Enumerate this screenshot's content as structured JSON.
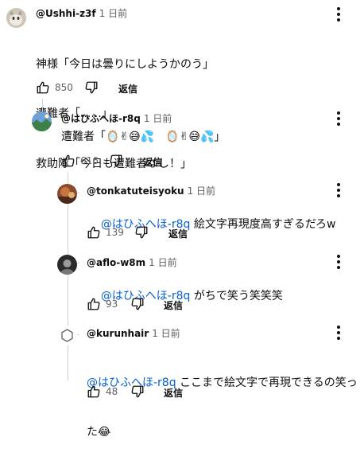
{
  "comments": [
    {
      "handle": "@Ushhi-z3f",
      "time": "1 日前",
      "lines": [
        "神様「今日は曇りにしようかのう」",
        "遭難者「......」",
        "救助隊「今日も遭難者なし！」"
      ],
      "likes": "850",
      "reply_label": "返信",
      "avatar_icon": "cat-avatar-icon"
    },
    {
      "handle": "@はひふへほ-r8q",
      "time": "1 日前",
      "text": "遭難者「🪞✌😅💦　🪞✌😅💦」",
      "likes": "616",
      "reply_label": "返信",
      "avatar_icon": "landscape-avatar-icon"
    },
    {
      "handle": "@tonkatuteisyoku",
      "time": "1 日前",
      "mention": "@はひふへほ-r8q",
      "text": " 絵文字再現度高すぎるだろw",
      "likes": "139",
      "reply_label": "返信",
      "avatar_icon": "photo-avatar-icon"
    },
    {
      "handle": "@aflo-w8m",
      "time": "1 日前",
      "mention": "@はひふへほ-r8q",
      "text": " がちで笑う笑笑笑",
      "likes": "93",
      "reply_label": "返信",
      "avatar_icon": "dark-avatar-icon"
    },
    {
      "handle": "@kurunhair",
      "time": "1 日前",
      "mention": "@はひふへほ-r8q",
      "text": " ここまで絵文字で再現できるの笑っ",
      "text2": "た😂",
      "likes": "48",
      "reply_label": "返信",
      "avatar_icon": "hexagon-avatar-icon"
    }
  ],
  "colors": {
    "mention": "#065fd4",
    "meta_gray": "#606060",
    "thread_line": "#d0d0d0"
  }
}
